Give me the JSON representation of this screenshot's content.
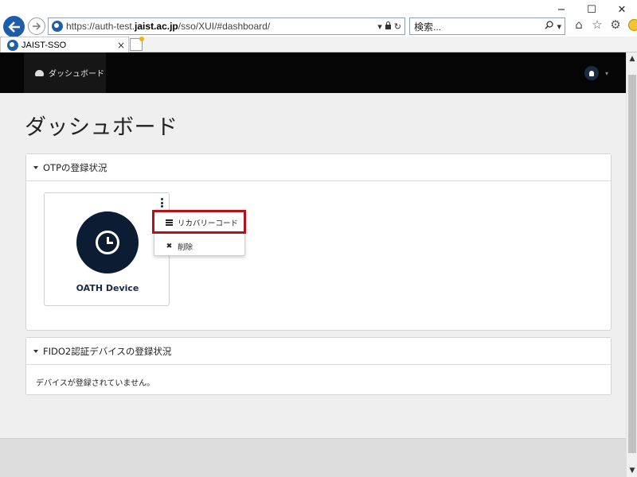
{
  "browser": {
    "url_prefix": "https://auth-test.",
    "url_domain": "jaist.ac.jp",
    "url_suffix": "/sso/XUI/#dashboard/",
    "search_placeholder": "検索...",
    "tab_title": "JAIST-SSO",
    "tab_close": "×",
    "window_minimize": "−",
    "window_maximize": "☐",
    "window_close": "✕"
  },
  "navbar": {
    "dashboard_label": "ダッシュボード"
  },
  "page": {
    "title": "ダッシュボード"
  },
  "otp_panel": {
    "title": "OTPの登録状況",
    "device_name": "OATH Device"
  },
  "dropdown": {
    "recovery_code_label": "リカバリーコード",
    "delete_label": "削除"
  },
  "fido_panel": {
    "title": "FIDO2認証デバイスの登録状況",
    "empty_message": "デバイスが登録されていません。"
  },
  "colors": {
    "navbar_bg": "#050505",
    "device_circle": "#0c1c33",
    "highlight": "#b3121b",
    "back_button": "#1e5ea8"
  }
}
